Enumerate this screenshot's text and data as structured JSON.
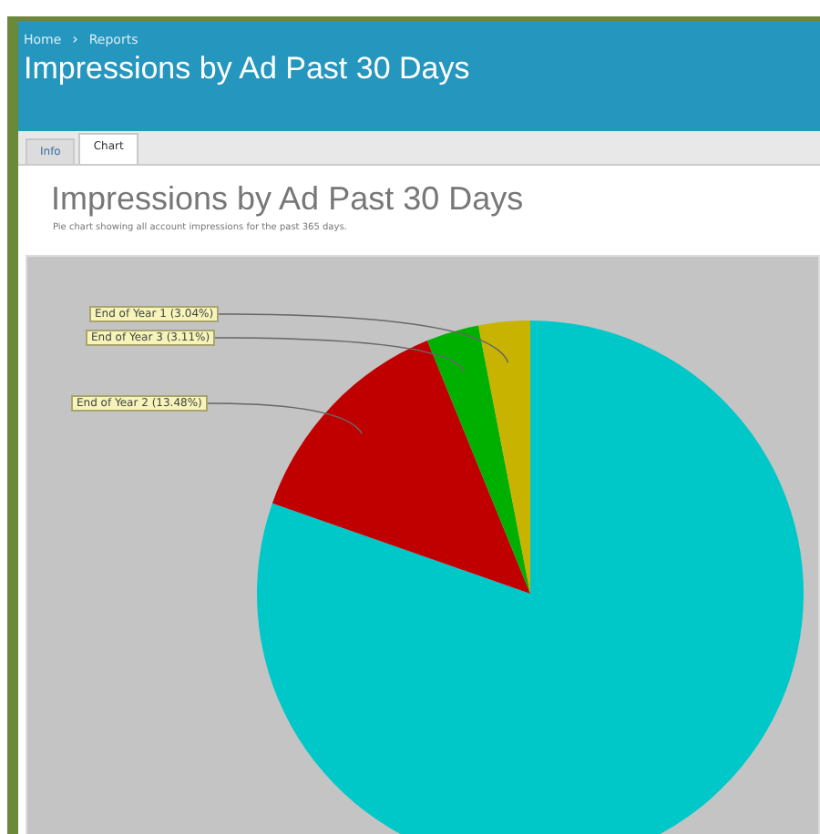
{
  "header": {
    "breadcrumb": [
      "Home",
      "Reports"
    ],
    "separator": "›",
    "title": "Impressions by Ad Past 30 Days"
  },
  "tabs": [
    {
      "label": "Info",
      "selected": false
    },
    {
      "label": "Chart",
      "selected": true
    }
  ],
  "content": {
    "title": "Impressions by Ad Past 30 Days",
    "subtitle": "Pie chart showing all account impressions for the past 365 days.",
    "chart_data": {
      "type": "pie",
      "categories": [
        null,
        "End of Year 2 (13.48%)",
        "End of Year 3 (3.11%)",
        "End of Year 1 (3.04%)"
      ],
      "values": [
        80.37,
        13.48,
        3.11,
        3.04
      ],
      "colors": [
        "#00c8c8",
        "#c00000",
        "#00b000",
        "#c8b400"
      ]
    }
  }
}
